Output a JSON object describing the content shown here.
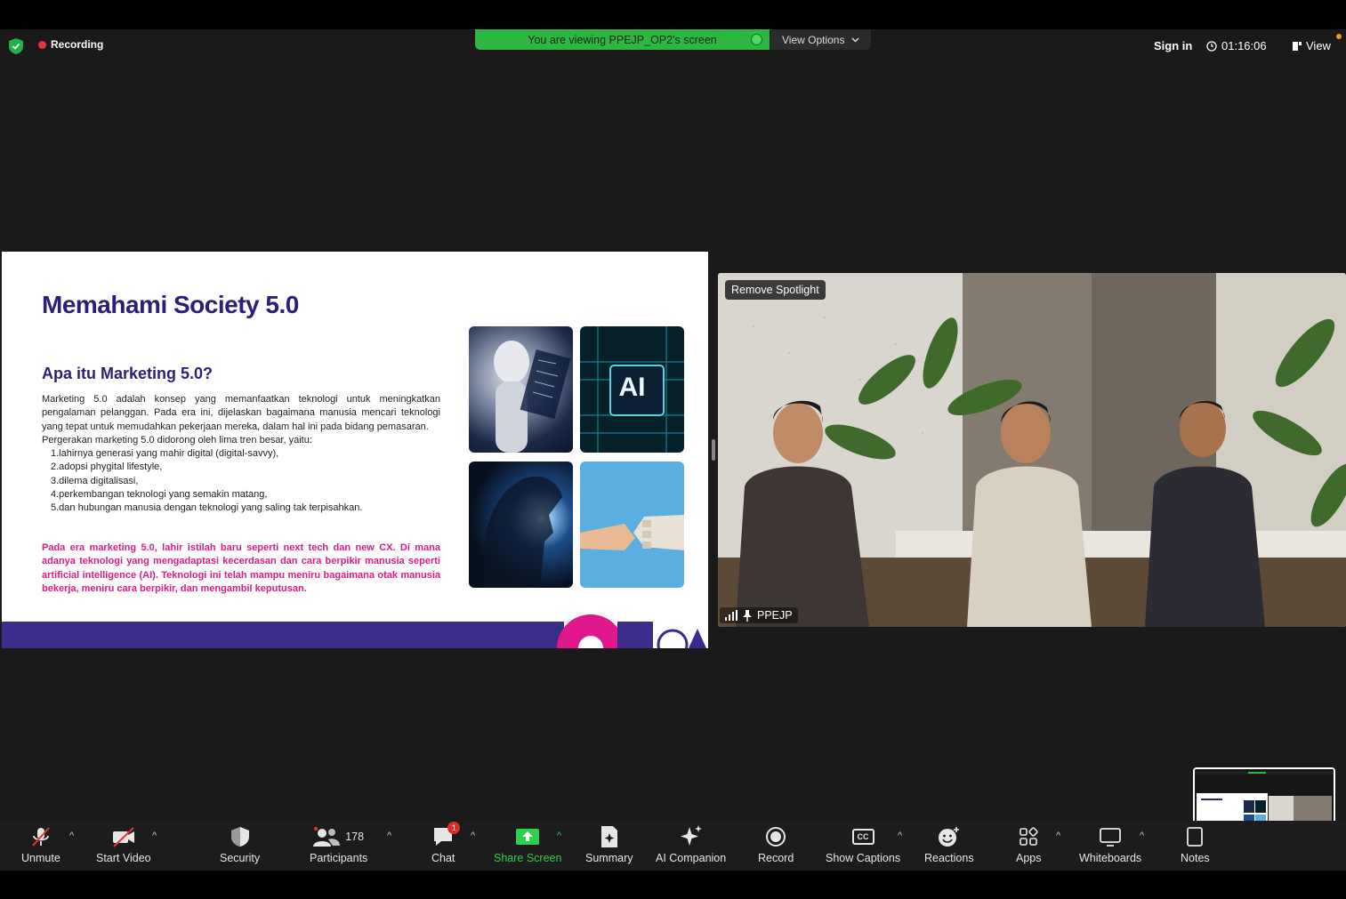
{
  "top_bar": {
    "recording_label": "Recording",
    "viewing_banner": "You are viewing PPEJP_OP2's screen",
    "view_options_label": "View Options",
    "sign_in_label": "Sign in",
    "timer": "01:16:06",
    "view_label": "View"
  },
  "slide": {
    "title": "Memahami Society 5.0",
    "subtitle": "Apa itu Marketing 5.0?",
    "paragraph1": "Marketing 5.0 adalah konsep yang memanfaatkan teknologi untuk meningkatkan pengalaman pelanggan. Pada era ini, dijelaskan bagaimana manusia mencari teknologi yang tepat untuk memudahkan pekerjaan mereka, dalam hal ini pada bidang pemasaran.",
    "paragraph2": "Pergerakan marketing 5.0 didorong oleh lima tren besar, yaitu:",
    "trends": [
      "1.lahirnya generasi yang mahir digital (digital-savvy),",
      "2.adopsi phygital lifestyle,",
      "3.dilema digitalisasi,",
      "4.perkembangan teknologi yang semakin matang,",
      "5.dan hubungan manusia dengan teknologi yang saling tak terpisahkan."
    ],
    "highlight": "Pada era marketing 5.0, lahir istilah baru seperti next tech dan new CX. Di mana adanya teknologi yang mengadaptasi kecerdasan dan cara berpikir manusia seperti artificial intelligence (AI). Teknologi ini telah mampu meniru bagaimana otak manusia bekerja, meniru cara berpikir, dan mengambil keputusan.",
    "ai_chip_text": "AI"
  },
  "video": {
    "remove_spotlight_label": "Remove Spotlight",
    "participant_name": "PPEJP"
  },
  "toolbar": {
    "unmute": "Unmute",
    "start_video": "Start Video",
    "security": "Security",
    "participants": "Participants",
    "participants_count": "178",
    "chat": "Chat",
    "chat_badge": "1",
    "share_screen": "Share Screen",
    "summary": "Summary",
    "ai_companion": "AI Companion",
    "record": "Record",
    "show_captions": "Show Captions",
    "captions_icon_text": "CC",
    "reactions": "Reactions",
    "apps": "Apps",
    "whiteboards": "Whiteboards",
    "notes": "Notes"
  },
  "colors": {
    "slide_title": "#2c1f78",
    "slide_highlight": "#dd1a87",
    "banner_green": "#2db742",
    "share_green": "#2fcf4f",
    "recording_red": "#e5343b"
  },
  "icons": [
    "shield-check-icon",
    "recording-dot-icon",
    "screen-share-dot-icon",
    "chevron-down-icon",
    "clock-icon",
    "view-layout-icon",
    "muted-mic-icon",
    "video-off-icon",
    "security-shield-icon",
    "participants-icon",
    "chat-bubble-icon",
    "share-screen-arrow-icon",
    "summary-icon",
    "ai-sparkle-icon",
    "record-icon",
    "captions-icon",
    "reactions-icon",
    "apps-icon",
    "whiteboard-icon",
    "notes-icon",
    "signal-icon",
    "pin-icon"
  ]
}
